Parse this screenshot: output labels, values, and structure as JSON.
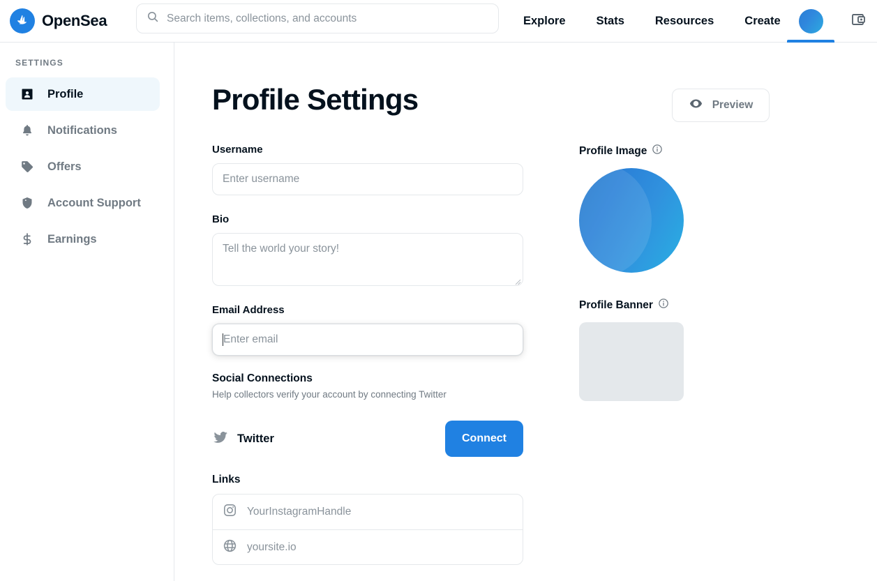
{
  "header": {
    "brand_name": "OpenSea",
    "logo_icon": "opensea-sailboat-logo",
    "search": {
      "icon": "search-icon",
      "placeholder": "Search items, collections, and accounts"
    },
    "nav_items": [
      {
        "label": "Explore"
      },
      {
        "label": "Stats"
      },
      {
        "label": "Resources"
      },
      {
        "label": "Create"
      }
    ],
    "account_avatar_icon": "account-avatar",
    "wallet_icon": "wallet-icon",
    "active_accent_color": "#2081e2"
  },
  "sidebar": {
    "heading": "SETTINGS",
    "items": [
      {
        "label": "Profile",
        "icon": "profile-card-icon",
        "active": true
      },
      {
        "label": "Notifications",
        "icon": "bell-icon",
        "active": false
      },
      {
        "label": "Offers",
        "icon": "tag-icon",
        "active": false
      },
      {
        "label": "Account Support",
        "icon": "shield-icon",
        "active": false
      },
      {
        "label": "Earnings",
        "icon": "dollar-icon",
        "active": false
      }
    ],
    "active_background_color": "#eff7fc"
  },
  "main": {
    "page_title": "Profile Settings",
    "preview_button": {
      "label": "Preview",
      "icon": "eye-icon"
    },
    "fields": {
      "username": {
        "label": "Username",
        "placeholder": "Enter username",
        "value": ""
      },
      "bio": {
        "label": "Bio",
        "placeholder": "Tell the world your story!",
        "value": ""
      },
      "email": {
        "label": "Email Address",
        "placeholder": "Enter email",
        "value": "",
        "focused": true
      }
    },
    "social_connections": {
      "title": "Social Connections",
      "subtitle": "Help collectors verify your account by connecting Twitter",
      "provider": {
        "name": "Twitter",
        "icon": "twitter-icon"
      },
      "connect_label": "Connect",
      "connect_color": "#2081e2"
    },
    "links": {
      "title": "Links",
      "rows": [
        {
          "icon": "instagram-icon",
          "placeholder": "YourInstagramHandle",
          "value": ""
        },
        {
          "icon": "globe-icon",
          "placeholder": "yoursite.io",
          "value": ""
        }
      ]
    },
    "media": {
      "profile_image": {
        "label": "Profile Image",
        "info_icon": "info-icon",
        "swatch": "blue-gradient-avatar"
      },
      "profile_banner": {
        "label": "Profile Banner",
        "info_icon": "info-icon",
        "color": "#e4e8eb"
      }
    }
  }
}
